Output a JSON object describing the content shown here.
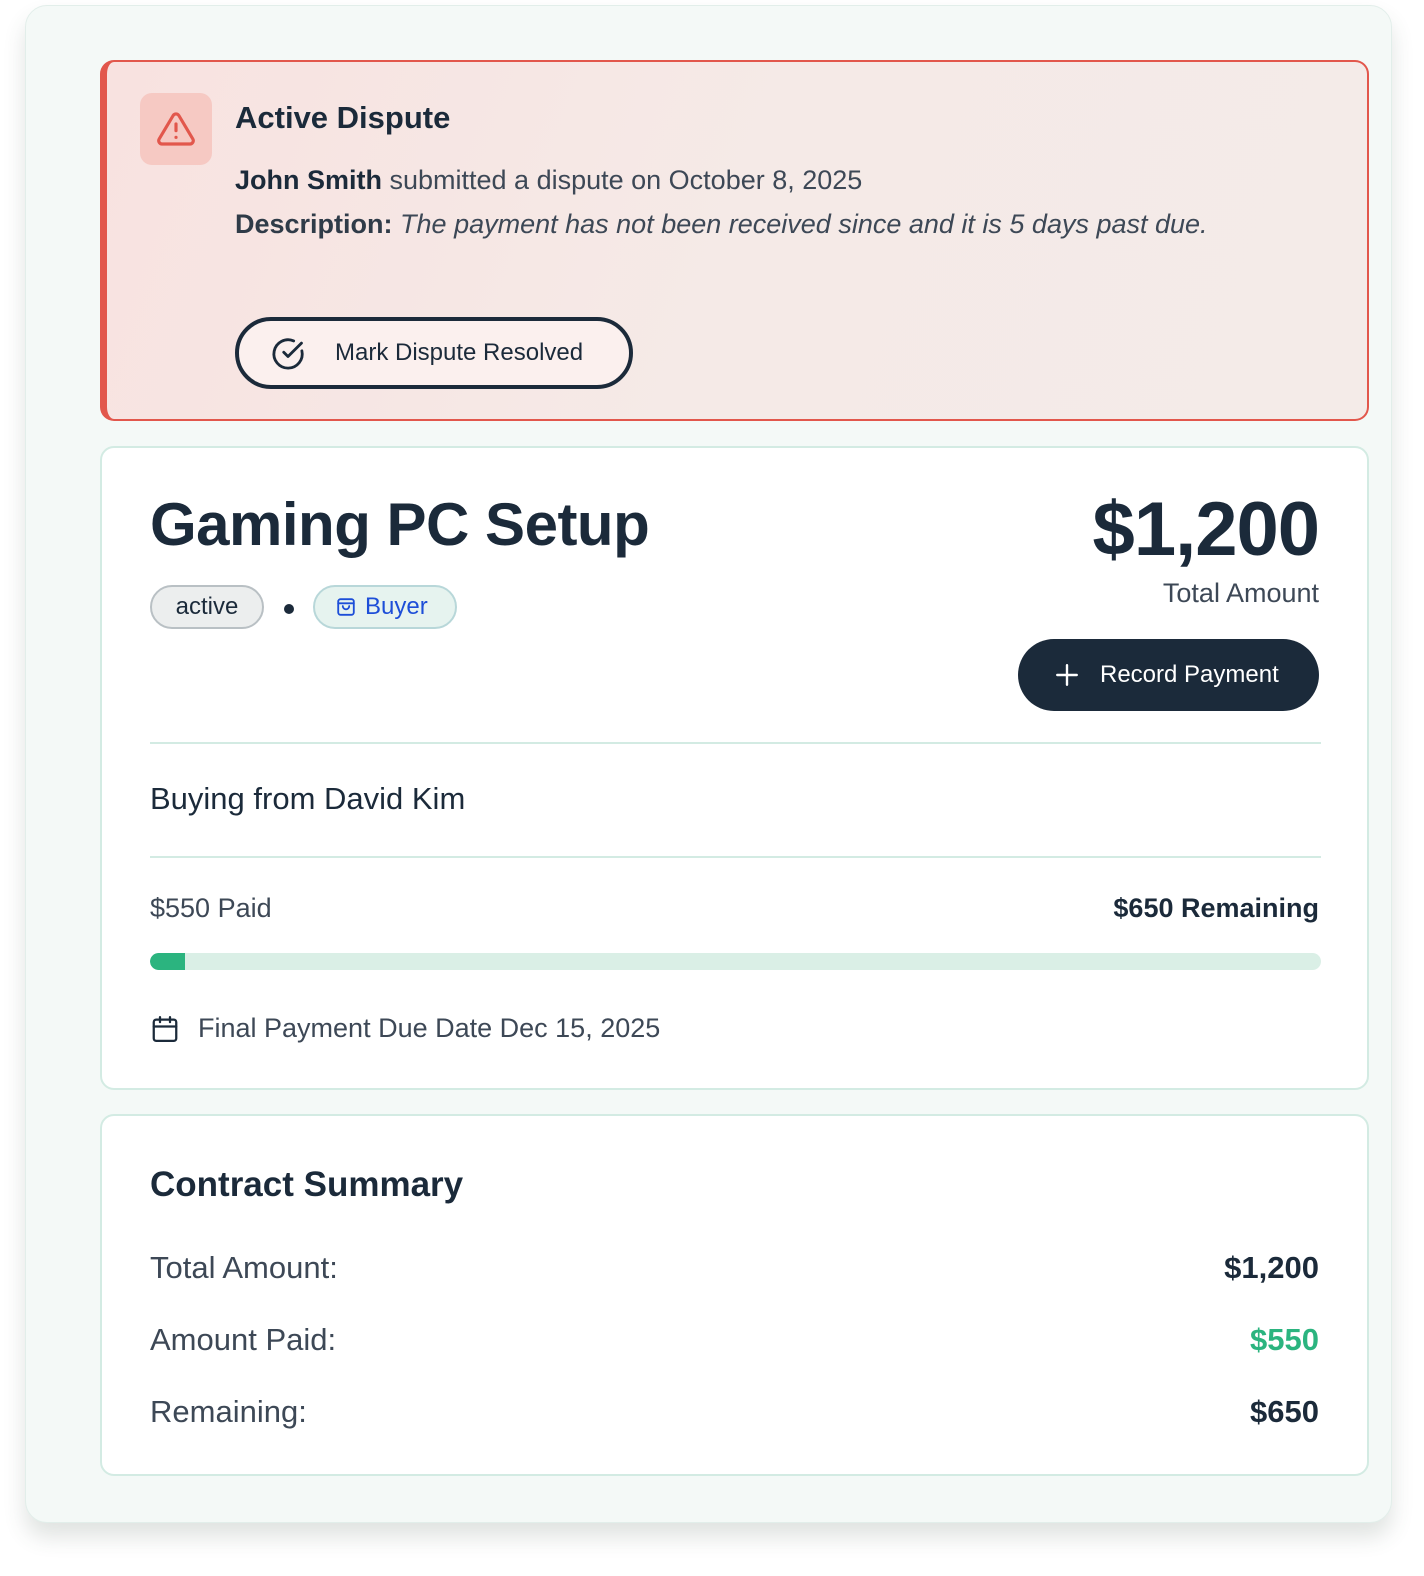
{
  "dispute": {
    "title": "Active Dispute",
    "submitter": "John Smith",
    "submitted_text": " submitted a dispute on October 8, 2025",
    "description_label": "Description:",
    "description": "The payment has not been received since and it is 5 days past due.",
    "resolve_label": "Mark Dispute Resolved",
    "icon": "warning-triangle-icon",
    "accent_color": "#e2574c"
  },
  "contract": {
    "title": "Gaming PC Setup",
    "status": "active",
    "role": "Buyer",
    "total_amount": "$1,200",
    "total_amount_label": "Total Amount",
    "record_payment_label": "Record Payment",
    "counterparty_text": "Buying from David Kim",
    "paid_text": "$550 Paid",
    "remaining_text": "$650 Remaining",
    "progress_fraction": 0.03,
    "due_text": "Final Payment Due Date Dec 15, 2025"
  },
  "summary": {
    "title": "Contract Summary",
    "rows": [
      {
        "label": "Total Amount:",
        "value": "$1,200"
      },
      {
        "label": "Amount Paid:",
        "value": "$550"
      },
      {
        "label": "Remaining:",
        "value": "$650"
      }
    ]
  },
  "colors": {
    "primary_dark": "#1b2a3a",
    "success_green": "#2bb47f",
    "buyer_blue": "#1d4ed8"
  }
}
